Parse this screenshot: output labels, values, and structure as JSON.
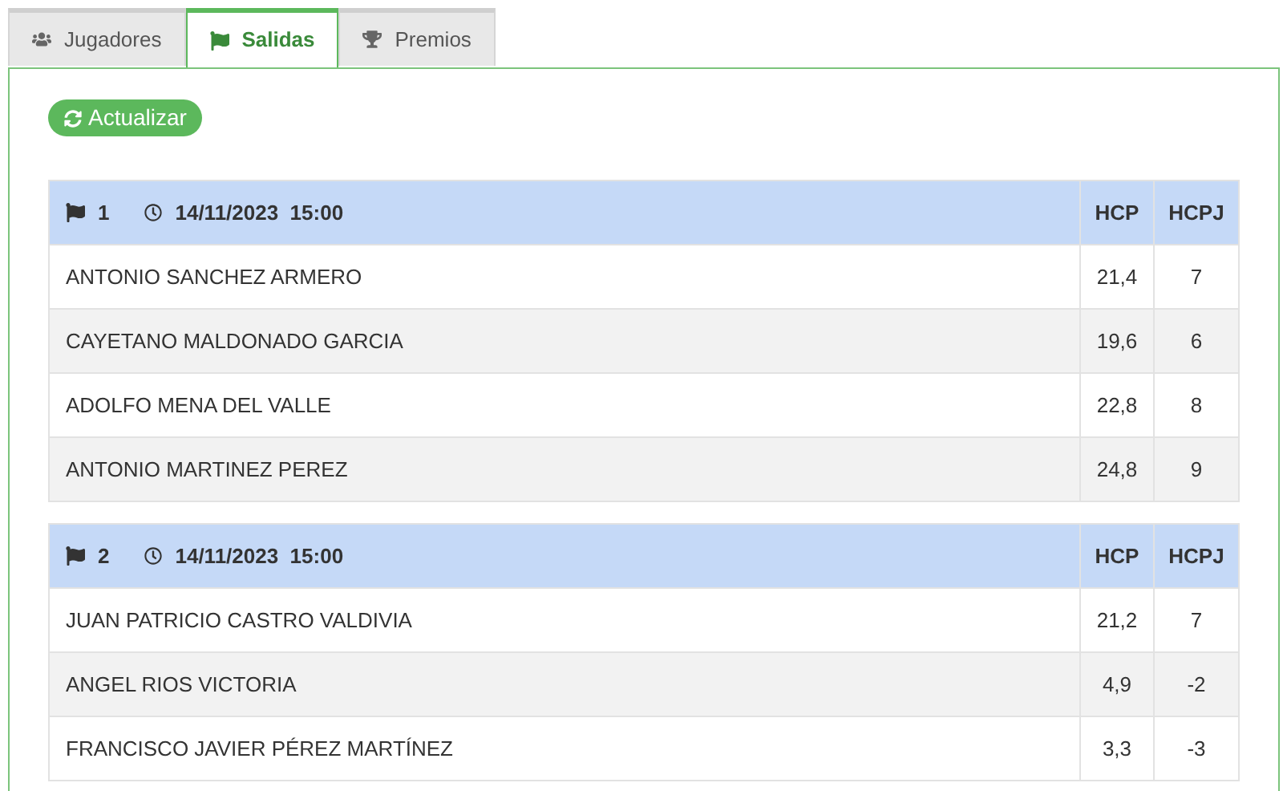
{
  "tabs": [
    {
      "label": "Jugadores",
      "kind": "users",
      "selected": false
    },
    {
      "label": "Salidas",
      "kind": "flag",
      "selected": true
    },
    {
      "label": "Premios",
      "kind": "trophy",
      "selected": false
    }
  ],
  "refresh_button": {
    "label": "Actualizar"
  },
  "groups": [
    {
      "number": "1",
      "datetime": "14/11/2023  15:00",
      "columns": [
        "HCP",
        "HCPJ"
      ],
      "rows": [
        {
          "name": "ANTONIO SANCHEZ ARMERO",
          "hcp": "21,4",
          "hcpj": "7"
        },
        {
          "name": "CAYETANO MALDONADO GARCIA",
          "hcp": "19,6",
          "hcpj": "6"
        },
        {
          "name": "ADOLFO MENA DEL VALLE",
          "hcp": "22,8",
          "hcpj": "8"
        },
        {
          "name": "ANTONIO MARTINEZ PEREZ",
          "hcp": "24,8",
          "hcpj": "9"
        }
      ]
    },
    {
      "number": "2",
      "datetime": "14/11/2023  15:00",
      "columns": [
        "HCP",
        "HCPJ"
      ],
      "rows": [
        {
          "name": "JUAN PATRICIO CASTRO VALDIVIA",
          "hcp": "21,2",
          "hcpj": "7"
        },
        {
          "name": "ANGEL RIOS VICTORIA",
          "hcp": "4,9",
          "hcpj": "-2"
        },
        {
          "name": "FRANCISCO JAVIER PÉREZ MARTÍNEZ",
          "hcp": "3,3",
          "hcpj": "-3"
        }
      ]
    }
  ]
}
